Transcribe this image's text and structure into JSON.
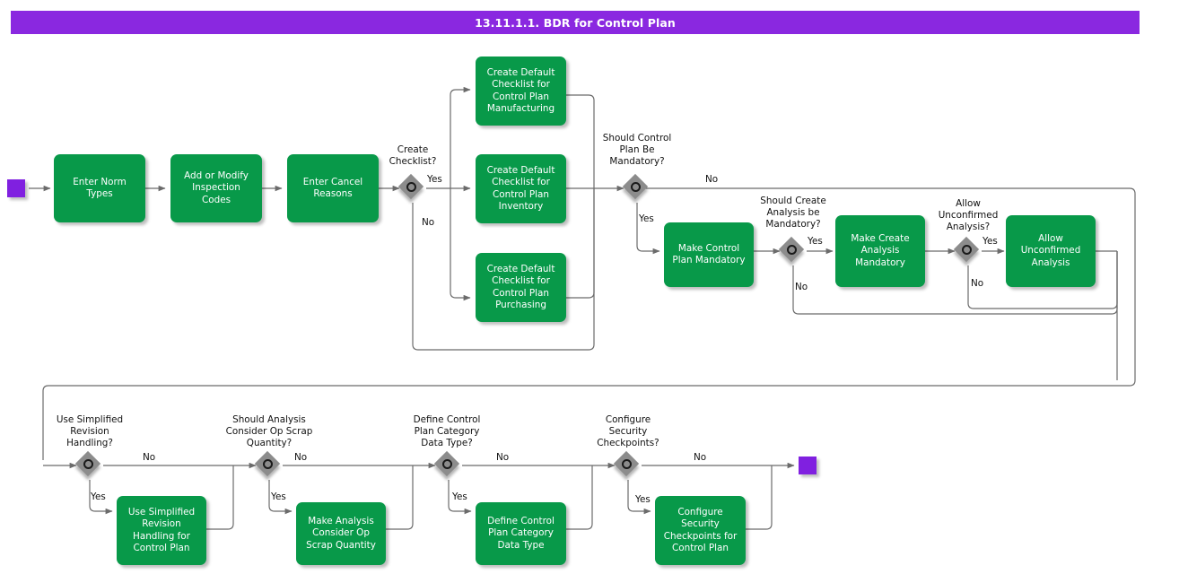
{
  "title": "13.11.1.1. BDR for Control Plan",
  "terminators": {
    "start": "start-event",
    "end": "end-event"
  },
  "tasks": [
    {
      "id": "enter-norm-types",
      "label": "Enter Norm\nTypes"
    },
    {
      "id": "add-modify-inspection-codes",
      "label": "Add or Modify\nInspection\nCodes"
    },
    {
      "id": "enter-cancel-reasons",
      "label": "Enter Cancel\nReasons"
    },
    {
      "id": "checklist-manufacturing",
      "label": "Create Default\nChecklist for\nControl Plan\nManufacturing"
    },
    {
      "id": "checklist-inventory",
      "label": "Create Default\nChecklist for\nControl Plan\nInventory"
    },
    {
      "id": "checklist-purchasing",
      "label": "Create Default\nChecklist for\nControl Plan\nPurchasing"
    },
    {
      "id": "make-control-plan-mandatory",
      "label": "Make Control\nPlan Mandatory"
    },
    {
      "id": "make-create-analysis-mandatory",
      "label": "Make Create\nAnalysis\nMandatory"
    },
    {
      "id": "allow-unconfirmed-analysis",
      "label": "Allow\nUnconfirmed\nAnalysis"
    },
    {
      "id": "use-simplified-revision-handling",
      "label": "Use Simplified\nRevision\nHandling for\nControl Plan"
    },
    {
      "id": "make-analysis-consider-op-scrap",
      "label": "Make Analysis\nConsider Op\nScrap Quantity"
    },
    {
      "id": "define-control-plan-category-data-type",
      "label": "Define Control\nPlan Category\nData Type"
    },
    {
      "id": "configure-security-checkpoints",
      "label": "Configure\nSecurity\nCheckpoints for\nControl Plan"
    }
  ],
  "gateways": [
    {
      "id": "create-checklist",
      "label": "Create\nChecklist?"
    },
    {
      "id": "control-plan-mandatory",
      "label": "Should Control\nPlan Be\nMandatory?"
    },
    {
      "id": "create-analysis-mandatory",
      "label": "Should Create\nAnalysis be\nMandatory?"
    },
    {
      "id": "allow-unconfirmed-analysis",
      "label": "Allow\nUnconfirmed\nAnalysis?"
    },
    {
      "id": "use-simplified-revision",
      "label": "Use Simplified\nRevision\nHandling?"
    },
    {
      "id": "analysis-consider-op-scrap",
      "label": "Should Analysis\nConsider Op Scrap\nQuantity?"
    },
    {
      "id": "define-category-data-type",
      "label": "Define Control\nPlan Category\nData Type?"
    },
    {
      "id": "configure-security",
      "label": "Configure\nSecurity\nCheckpoints?"
    }
  ],
  "edge_labels": {
    "checklist_yes": "Yes",
    "checklist_no": "No",
    "mandatory_yes": "Yes",
    "mandatory_no": "No",
    "analysis_yes": "Yes",
    "analysis_no": "No",
    "unconfirmed_yes": "Yes",
    "unconfirmed_no": "No",
    "revision_yes": "Yes",
    "revision_no": "No",
    "scrap_yes": "Yes",
    "scrap_no": "No",
    "datatype_yes": "Yes",
    "datatype_no": "No",
    "security_yes": "Yes",
    "security_no": "No"
  },
  "colors": {
    "title_bar": "#8a28e0",
    "task_fill": "#089949",
    "terminator": "#8020e0",
    "gateway": "#8c8c8c",
    "connector": "#666666",
    "text_light": "#ffffff",
    "text_dark": "#111111"
  }
}
